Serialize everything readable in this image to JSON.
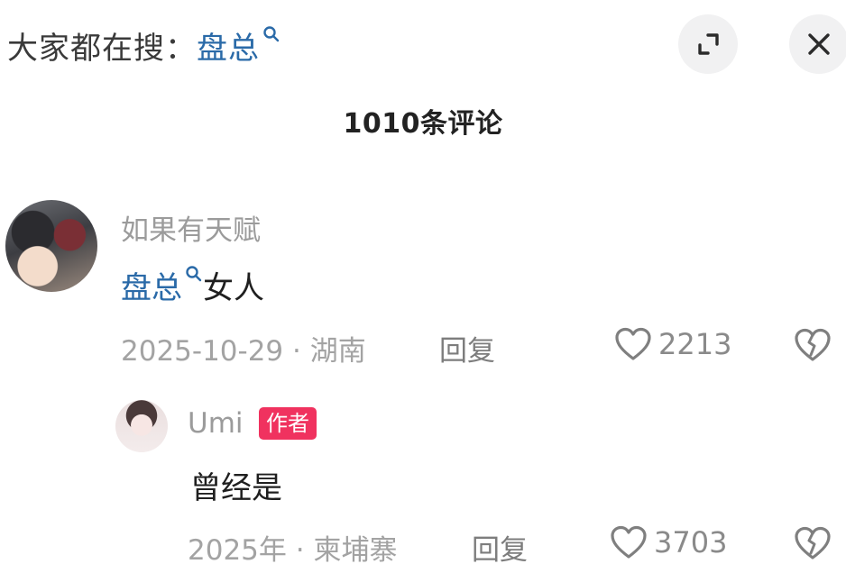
{
  "header": {
    "search_prefix": "大家都在搜：",
    "search_term": "盘总",
    "expand_icon": "expand-icon",
    "close_icon": "close-icon"
  },
  "comments_title": "1010条评论",
  "comments": [
    {
      "username": "如果有天赋",
      "highlight": "盘总",
      "text": "女人",
      "date_location": "2025-10-29 · 湖南",
      "reply_label": "回复",
      "likes": "2213"
    },
    {
      "username": "Umi",
      "badge": "作者",
      "text": "曾经是",
      "date_location": "2025年 · 柬埔寨",
      "reply_label": "回复",
      "likes": "3703"
    }
  ],
  "colors": {
    "link_blue": "#2a6aa8",
    "author_badge": "#f0325f",
    "muted_text": "#a3a3a3"
  }
}
